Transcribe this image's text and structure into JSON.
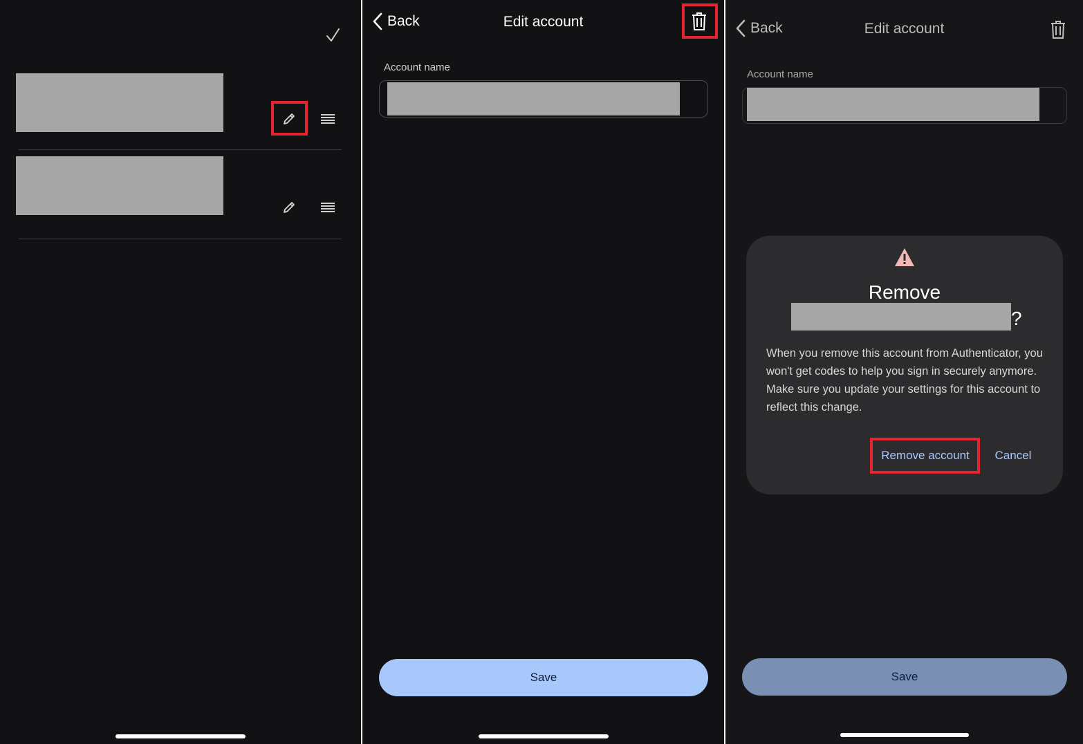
{
  "panel1": {
    "done_icon": "checkmark-icon",
    "edit_icon": "pencil-icon",
    "reorder_icon": "drag-handle-icon"
  },
  "panel2": {
    "back_label": "Back",
    "title": "Edit account",
    "delete_icon": "trash-icon",
    "field_label": "Account name",
    "save_label": "Save"
  },
  "panel3": {
    "back_label": "Back",
    "title": "Edit account",
    "delete_icon": "trash-icon",
    "field_label": "Account name",
    "save_label": "Save",
    "dialog": {
      "warning_icon": "warning-icon",
      "title": "Remove",
      "title_suffix": "?",
      "body": "When you remove this account from Authenticator, you won't get codes to help you sign in securely anymore. Make sure you update your settings for this account to reflect this change.",
      "confirm_label": "Remove account",
      "cancel_label": "Cancel"
    }
  },
  "colors": {
    "background": "#121214",
    "accent_button": "#a8c7fa",
    "dimmed_button": "#7a8fb4",
    "highlight": "#e3262e",
    "dialog_link": "#aac7ff",
    "warning": "#f2b8b5"
  }
}
